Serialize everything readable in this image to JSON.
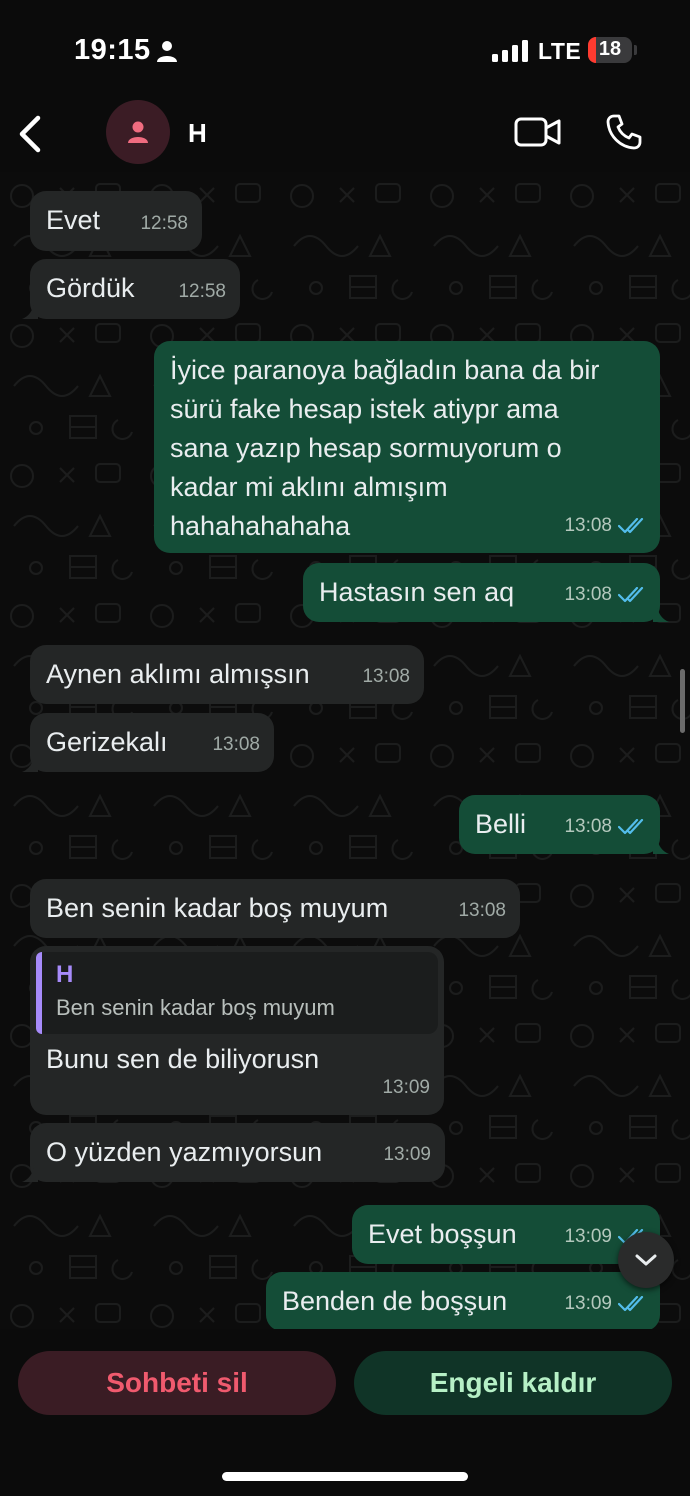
{
  "status_bar": {
    "time": "19:15",
    "network": "LTE",
    "battery": "18",
    "battery_level": 0.18
  },
  "header": {
    "contact_name": "H"
  },
  "messages": [
    {
      "direction": "in",
      "text": "Evet",
      "time": "12:58"
    },
    {
      "direction": "in",
      "text": "Gördük",
      "time": "12:58"
    },
    {
      "direction": "out",
      "text": "İyice paranoya bağladın bana da bir\nsürü fake hesap istek atiypr ama\nsana yazıp hesap sormuyorum o\nkadar mi aklını almışım\nhahahahahaha",
      "time": "13:08",
      "status": "read"
    },
    {
      "direction": "out",
      "text": "Hastasın sen aq",
      "time": "13:08",
      "status": "read"
    },
    {
      "direction": "in",
      "text": "Aynen aklımı almışsın",
      "time": "13:08"
    },
    {
      "direction": "in",
      "text": "Gerizekalı",
      "time": "13:08"
    },
    {
      "direction": "out",
      "text": "Belli",
      "time": "13:08",
      "status": "read"
    },
    {
      "direction": "in",
      "text": "Ben senin kadar boş muyum",
      "time": "13:08"
    },
    {
      "direction": "in",
      "text": "Bunu sen de biliyorusn",
      "time": "13:09",
      "quote": {
        "author": "H",
        "text": "Ben senin kadar boş muyum"
      }
    },
    {
      "direction": "in",
      "text": "O yüzden yazmıyorsun",
      "time": "13:09"
    },
    {
      "direction": "out",
      "text": "Evet boşşun",
      "time": "13:09",
      "status": "read"
    },
    {
      "direction": "out",
      "text": "Benden de boşşun",
      "time": "13:09",
      "status": "read"
    }
  ],
  "actions": {
    "delete_chat": "Sohbeti sil",
    "unblock": "Engeli kaldır"
  },
  "colors": {
    "incoming_bubble": "#242626",
    "outgoing_bubble": "#144d37",
    "read_ticks": "#53bdeb",
    "quote_accent": "#a78bfa",
    "delete_text": "#f05a6e",
    "unblock_text": "#b6f0c6"
  },
  "icons": {
    "back": "chevron-left-icon",
    "avatar": "person-icon",
    "video": "video-camera-icon",
    "call": "phone-icon",
    "scroll_down": "chevron-down-icon",
    "read": "double-check-icon"
  }
}
